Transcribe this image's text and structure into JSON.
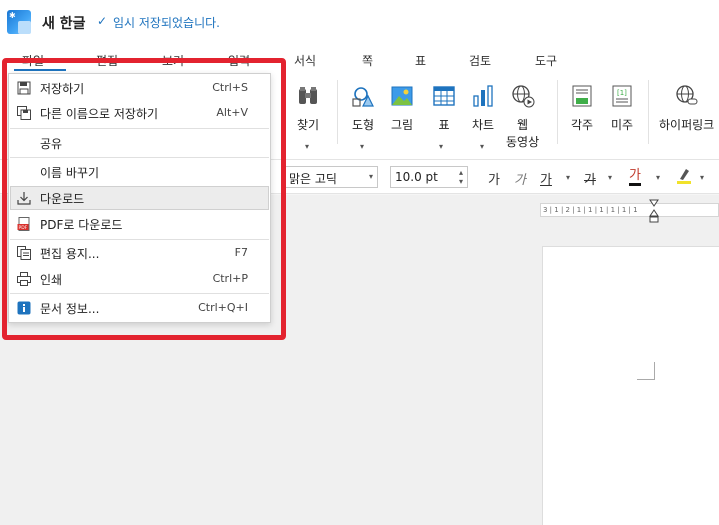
{
  "titlebar": {
    "doc_title": "새 한글",
    "save_status": "임시 저장되었습니다."
  },
  "menubar": {
    "tabs": [
      "파일",
      "편집",
      "보기",
      "입력",
      "서식",
      "쪽",
      "표",
      "검토",
      "도구"
    ]
  },
  "ribbon": {
    "find": "찾기",
    "shape": "도형",
    "picture": "그림",
    "table": "표",
    "chart": "차트",
    "web_video_line1": "웹",
    "web_video_line2": "동영상",
    "footnote": "각주",
    "endnote": "미주",
    "hyperlink": "하이퍼링크"
  },
  "formatbar": {
    "font": "맑은 고딕",
    "size": "10.0  pt",
    "char_buttons": [
      "가",
      "가",
      "가",
      "가",
      "가"
    ]
  },
  "ruler": {
    "text": "3 | 1 | 2 | 1 | 1 | 1 | 1 | 1 | 1"
  },
  "file_menu": {
    "items": [
      {
        "label": "저장하기",
        "shortcut": "Ctrl+S",
        "icon": "floppy-icon"
      },
      {
        "label": "다른 이름으로 저장하기",
        "shortcut": "Alt+V",
        "icon": "save-as-icon"
      },
      {
        "label": "공유",
        "shortcut": "",
        "icon": ""
      },
      {
        "label": "이름 바꾸기",
        "shortcut": "",
        "icon": ""
      },
      {
        "label": "다운로드",
        "shortcut": "",
        "icon": "download-icon"
      },
      {
        "label": "PDF로 다운로드",
        "shortcut": "",
        "icon": "pdf-icon"
      },
      {
        "label": "편집 용지...",
        "shortcut": "F7",
        "icon": "page-setup-icon"
      },
      {
        "label": "인쇄",
        "shortcut": "Ctrl+P",
        "icon": "printer-icon"
      },
      {
        "label": "문서 정보...",
        "shortcut": "Ctrl+Q+I",
        "icon": "info-icon"
      }
    ]
  },
  "colors": {
    "accent": "#1e73be",
    "highlight_border": "#e3232f",
    "font_color": "#c0392b",
    "highlight_color": "#f1e22a"
  }
}
